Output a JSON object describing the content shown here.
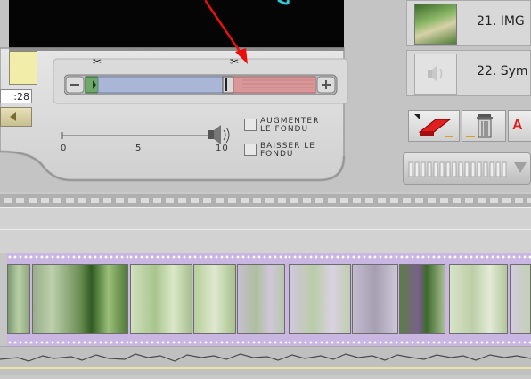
{
  "window": {
    "title": ""
  },
  "preview": {
    "time_display": ":28"
  },
  "trim": {
    "marker_start_icon": "scissors-icon",
    "marker_end_icon": "scissors-icon",
    "zoom_out_label": "−",
    "zoom_in_label": "+",
    "colors": {
      "kept": "#a9b6d6",
      "cut": "#d9979a",
      "handle": "#6ea86a"
    }
  },
  "volume": {
    "icon": "speaker-icon",
    "ticks": [
      "0",
      "5",
      "10"
    ]
  },
  "fade": {
    "increase_line1": "AUGMENTER",
    "increase_line2": "LE FONDU",
    "decrease_line1": "BAISSER LE",
    "decrease_line2": "FONDU"
  },
  "media_list": {
    "items": [
      {
        "label": "21. IMG",
        "icon": "image-icon"
      },
      {
        "label": "22. Sym",
        "icon": "speaker-icon"
      }
    ]
  },
  "toolbar": {
    "buttons": [
      {
        "icon": "eraser-icon"
      },
      {
        "icon": "trash-icon"
      },
      {
        "icon": "text-icon",
        "label": "A"
      }
    ]
  },
  "timeline": {
    "clip_color": "#c9b6e3",
    "frame_count": 8
  }
}
